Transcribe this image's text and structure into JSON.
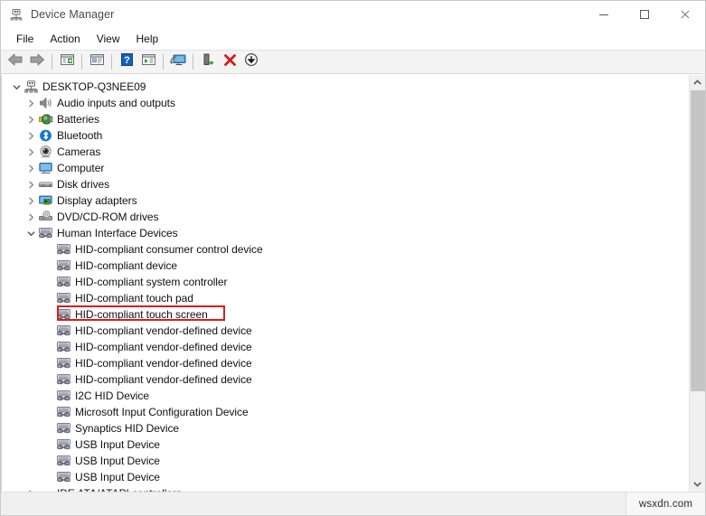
{
  "window": {
    "title": "Device Manager",
    "icon": "device-manager-icon",
    "controls": [
      {
        "name": "minimize-button",
        "glyph": "minimize"
      },
      {
        "name": "maximize-button",
        "glyph": "maximize"
      },
      {
        "name": "close-button",
        "glyph": "close"
      }
    ]
  },
  "menu": {
    "items": [
      {
        "label": "File"
      },
      {
        "label": "Action"
      },
      {
        "label": "View"
      },
      {
        "label": "Help"
      }
    ]
  },
  "toolbar": {
    "buttons": [
      {
        "name": "back-button",
        "icon": "back-arrow-icon"
      },
      {
        "name": "forward-button",
        "icon": "forward-arrow-icon"
      },
      {
        "name": "separator-1",
        "icon": "separator"
      },
      {
        "name": "show-hide-console-tree-button",
        "icon": "console-tree-icon"
      },
      {
        "name": "separator-2",
        "icon": "separator"
      },
      {
        "name": "properties-button",
        "icon": "properties-icon"
      },
      {
        "name": "separator-3",
        "icon": "separator"
      },
      {
        "name": "help-button",
        "icon": "help-question-icon"
      },
      {
        "name": "scan-for-hardware-changes-button",
        "icon": "scan-hardware-icon"
      },
      {
        "name": "separator-4",
        "icon": "separator"
      },
      {
        "name": "update-driver-button",
        "icon": "update-driver-monitor-icon"
      },
      {
        "name": "separator-5",
        "icon": "separator"
      },
      {
        "name": "enable-device-button",
        "icon": "enable-device-icon"
      },
      {
        "name": "uninstall-device-button",
        "icon": "uninstall-red-x-icon"
      },
      {
        "name": "disable-device-button",
        "icon": "disable-down-arrow-icon"
      }
    ]
  },
  "tree": {
    "rows": [
      {
        "level": 0,
        "twisty": "expanded",
        "icon": "computer-device-icon",
        "label": "DESKTOP-Q3NEE09"
      },
      {
        "level": 1,
        "twisty": "collapsed",
        "icon": "audio-icon",
        "label": "Audio inputs and outputs"
      },
      {
        "level": 1,
        "twisty": "collapsed",
        "icon": "battery-icon",
        "label": "Batteries"
      },
      {
        "level": 1,
        "twisty": "collapsed",
        "icon": "bluetooth-icon",
        "label": "Bluetooth"
      },
      {
        "level": 1,
        "twisty": "collapsed",
        "icon": "camera-icon",
        "label": "Cameras"
      },
      {
        "level": 1,
        "twisty": "collapsed",
        "icon": "monitor-icon",
        "label": "Computer"
      },
      {
        "level": 1,
        "twisty": "collapsed",
        "icon": "disk-drive-icon",
        "label": "Disk drives"
      },
      {
        "level": 1,
        "twisty": "collapsed",
        "icon": "display-adapter-icon",
        "label": "Display adapters"
      },
      {
        "level": 1,
        "twisty": "collapsed",
        "icon": "dvd-drive-icon",
        "label": "DVD/CD-ROM drives"
      },
      {
        "level": 1,
        "twisty": "expanded",
        "icon": "hid-icon",
        "label": "Human Interface Devices"
      },
      {
        "level": 2,
        "twisty": "none",
        "icon": "hid-icon",
        "label": "HID-compliant consumer control device"
      },
      {
        "level": 2,
        "twisty": "none",
        "icon": "hid-icon",
        "label": "HID-compliant device"
      },
      {
        "level": 2,
        "twisty": "none",
        "icon": "hid-icon",
        "label": "HID-compliant system controller"
      },
      {
        "level": 2,
        "twisty": "none",
        "icon": "hid-icon",
        "label": "HID-compliant touch pad"
      },
      {
        "level": 2,
        "twisty": "none",
        "icon": "hid-icon",
        "label": "HID-compliant touch screen",
        "highlighted": true
      },
      {
        "level": 2,
        "twisty": "none",
        "icon": "hid-icon",
        "label": "HID-compliant vendor-defined device"
      },
      {
        "level": 2,
        "twisty": "none",
        "icon": "hid-icon",
        "label": "HID-compliant vendor-defined device"
      },
      {
        "level": 2,
        "twisty": "none",
        "icon": "hid-icon",
        "label": "HID-compliant vendor-defined device"
      },
      {
        "level": 2,
        "twisty": "none",
        "icon": "hid-icon",
        "label": "HID-compliant vendor-defined device"
      },
      {
        "level": 2,
        "twisty": "none",
        "icon": "hid-icon",
        "label": "I2C HID Device"
      },
      {
        "level": 2,
        "twisty": "none",
        "icon": "hid-icon",
        "label": "Microsoft Input Configuration Device"
      },
      {
        "level": 2,
        "twisty": "none",
        "icon": "hid-icon",
        "label": "Synaptics HID Device"
      },
      {
        "level": 2,
        "twisty": "none",
        "icon": "hid-icon",
        "label": "USB Input Device"
      },
      {
        "level": 2,
        "twisty": "none",
        "icon": "hid-icon",
        "label": "USB Input Device"
      },
      {
        "level": 2,
        "twisty": "none",
        "icon": "hid-icon",
        "label": "USB Input Device"
      },
      {
        "level": 1,
        "twisty": "collapsed",
        "icon": "ide-controller-icon",
        "label": "IDE ATA/ATAPI controllers"
      }
    ],
    "highlight_color": "#e01b1b"
  },
  "scrollbar": {
    "up_arrow": "scroll-up-arrow-icon",
    "down_arrow": "scroll-down-arrow-icon",
    "thumb_percent": 78
  },
  "statusbar": {
    "text": "",
    "watermark": "wsxdn.com"
  }
}
